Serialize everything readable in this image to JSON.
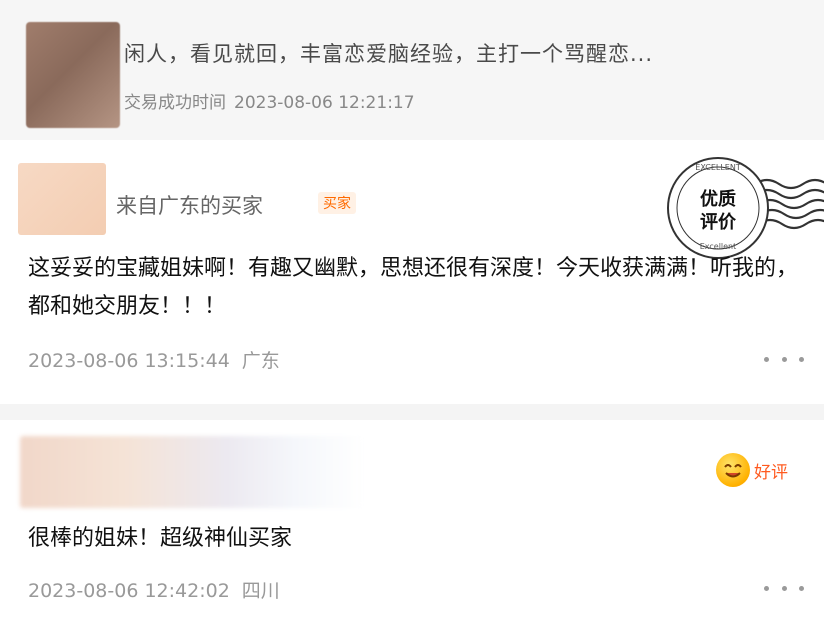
{
  "product": {
    "title": "闲人，看见就回，丰富恋爱脑经验，主打一个骂醒恋...",
    "time_label": "交易成功时间",
    "time_value": "2023-08-06 12:21:17"
  },
  "reviews": [
    {
      "name": "来自广东的买家",
      "badge": "买家",
      "stamp": {
        "icon": "excellent-review-stamp",
        "line1": "优质",
        "line2": "评价",
        "arc_top": "EXCELLENT",
        "arc_bottom": "Excellent"
      },
      "text": "这妥妥的宝藏姐妹啊！有趣又幽默，思想还很有深度！今天收获满满！听我的，都和她交朋友！！！",
      "time": "2023-08-06 13:15:44",
      "location": "广东"
    },
    {
      "badge_good": "好评",
      "badge_icon": "smiley-face-icon",
      "text": "很棒的姐妹！超级神仙买家",
      "time": "2023-08-06 12:42:02",
      "location": "四川"
    }
  ],
  "colors": {
    "accent_orange": "#ff6a00",
    "good_label": "#ff5a1f",
    "meta_gray": "#999999"
  }
}
